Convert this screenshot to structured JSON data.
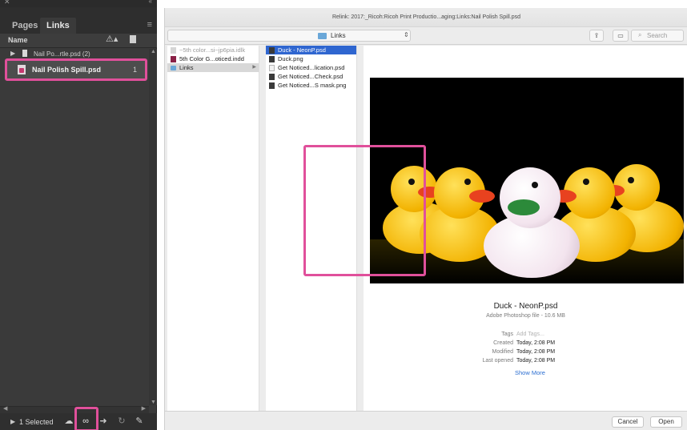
{
  "panel": {
    "tabs": [
      {
        "label": "Pages"
      },
      {
        "label": "Links"
      }
    ],
    "column_header": {
      "name": "Name"
    },
    "links": [
      {
        "name": "Nail Po...rtle.psd (2)",
        "page": ""
      },
      {
        "name": "Nail Polish Spill.psd",
        "page": "1"
      }
    ],
    "footer": {
      "selected": "1 Selected"
    },
    "icons": {
      "close": "close-icon",
      "menu": "panel-menu-icon",
      "warning": "warning-sort-icon",
      "page": "page-sort-icon",
      "cc_libraries": "cc-libraries-icon",
      "relink": "relink-icon",
      "goto": "go-to-link-icon",
      "update": "update-link-icon",
      "edit": "edit-original-icon"
    },
    "highlight_color": "#e0509b"
  },
  "dialog": {
    "title": "Relink: 2017:_Ricoh:Ricoh Print Productio...aging:Links:Nail Polish Spill.psd",
    "location": "Links",
    "search_placeholder": "Search",
    "columns": [
      {
        "items": [
          {
            "label": "~5th color...si~jp6pia.idlk",
            "kind": "idlk",
            "state": "dim"
          },
          {
            "label": "5th Color G...oticed.indd",
            "kind": "indd",
            "state": ""
          },
          {
            "label": "Links",
            "kind": "folder",
            "state": "selected"
          }
        ]
      },
      {
        "items": [
          {
            "label": "Duck - NeonP.psd",
            "kind": "img",
            "state": "active"
          },
          {
            "label": "Duck.png",
            "kind": "img",
            "state": ""
          },
          {
            "label": "Get Noticed...lication.psd",
            "kind": "psdw",
            "state": ""
          },
          {
            "label": "Get Noticed...Check.psd",
            "kind": "img",
            "state": ""
          },
          {
            "label": "Get Noticed...S mask.png",
            "kind": "img",
            "state": ""
          }
        ]
      }
    ],
    "preview": {
      "file_name": "Duck - NeonP.psd",
      "file_type": "Adobe Photoshop file - 10.6 MB",
      "metadata": [
        {
          "key": "Tags",
          "value": "Add Tags...",
          "placeholder": true
        },
        {
          "key": "Created",
          "value": "Today, 2:08 PM",
          "placeholder": false
        },
        {
          "key": "Modified",
          "value": "Today, 2:08 PM",
          "placeholder": false
        },
        {
          "key": "Last opened",
          "value": "Today, 2:08 PM",
          "placeholder": false
        }
      ],
      "show_more": "Show More"
    },
    "buttons": {
      "cancel": "Cancel",
      "open": "Open"
    },
    "accent_color": "#2f66d0"
  }
}
